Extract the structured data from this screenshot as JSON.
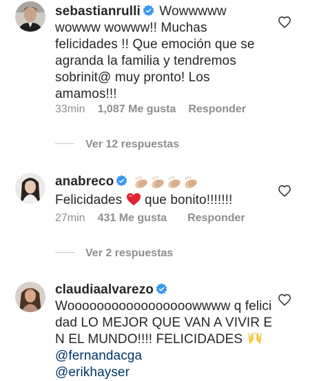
{
  "comments": [
    {
      "username": "sebastianrulli",
      "text": "Wowwwww wowww wowww!! Muchas felicidades !! Que emoción que se agranda la familia y tendremos sobrinit@ muy pronto! Los amamos!!!",
      "time": "33min",
      "likes": "1,087 Me gusta",
      "reply_label": "Responder",
      "view_replies": "Ver 12 respuestas"
    },
    {
      "username": "anabreco",
      "text_before": "Felicidades ",
      "text_after": " que bonito!!!!!!!",
      "time": "27min",
      "likes": "431 Me gusta",
      "reply_label": "Responder",
      "view_replies": "Ver 2 respuestas"
    },
    {
      "username": "claudiaalvarezo",
      "text": "Wooooooooooooooooowwww q felicidad LO MEJOR QUE VAN A VIVIR EN EL MUNDO!!!! FELICIDADES",
      "mention_1": "@fernandacga",
      "mention_2": "@erikhayser"
    }
  ],
  "icons": {
    "verified": "verified-badge-icon",
    "like": "heart-outline-icon",
    "clap": "clapping-hands-emoji",
    "red_heart": "red-heart-emoji",
    "raised_hands": "raised-hands-emoji"
  },
  "colors": {
    "text": "#262626",
    "meta": "#8e8e8e",
    "verified": "#3897f0",
    "mention": "#003569"
  }
}
